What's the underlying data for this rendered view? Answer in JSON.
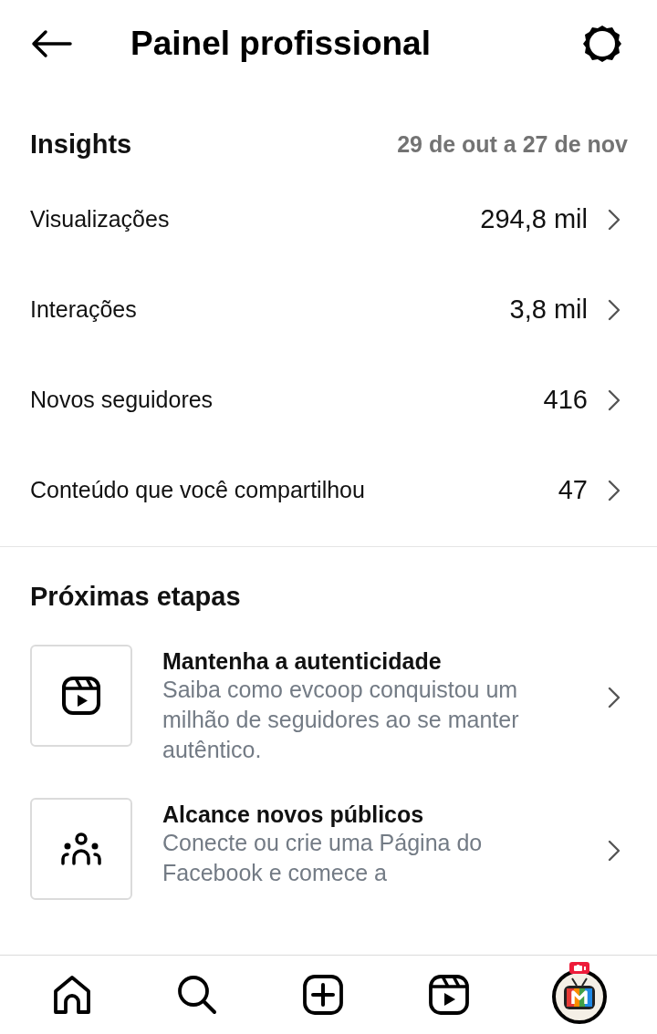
{
  "header": {
    "title": "Painel profissional"
  },
  "insights": {
    "title": "Insights",
    "date_range": "29 de out a 27 de nov",
    "rows": [
      {
        "label": "Visualizações",
        "value": "294,8 mil"
      },
      {
        "label": "Interações",
        "value": "3,8 mil"
      },
      {
        "label": "Novos seguidores",
        "value": "416"
      },
      {
        "label": "Conteúdo que você compartilhou",
        "value": "47"
      }
    ]
  },
  "next_steps": {
    "title": "Próximas etapas",
    "cards": [
      {
        "kind": "reels",
        "title": "Mantenha a autenticidade",
        "description": "Saiba como evcoop conquistou um milhão de seguidores ao se manter autêntico."
      },
      {
        "kind": "people",
        "title": "Alcance novos públicos",
        "description": "Conecte ou crie uma Página do Facebook e comece a"
      }
    ]
  },
  "nav": [
    {
      "kind": "home",
      "selected": false
    },
    {
      "kind": "search",
      "selected": false
    },
    {
      "kind": "create",
      "selected": false
    },
    {
      "kind": "reels",
      "selected": false
    },
    {
      "kind": "profile",
      "selected": true
    }
  ]
}
